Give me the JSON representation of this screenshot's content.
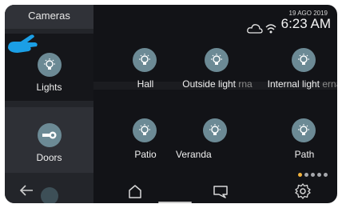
{
  "sidebar": {
    "cameras_label": "Cameras",
    "lights_label": "Lights",
    "doors_label": "Doors",
    "back_icon": "arrow-left-icon",
    "lights_icon": "bulb-icon",
    "doors_icon": "key-icon",
    "pointer_icon": "hand-pointer-icon"
  },
  "status": {
    "date": "19 AGO 2019",
    "time": "6:23 AM",
    "cloud_icon": "cloud-icon",
    "wifi_icon": "wifi-icon"
  },
  "tiles": [
    {
      "label": "Hall",
      "ghost": "",
      "icon": "bulb-icon"
    },
    {
      "label": "Outside light",
      "ghost": "rna",
      "icon": "bulb-icon"
    },
    {
      "label": "Internal light",
      "ghost": "erna",
      "icon": "bulb-icon"
    },
    {
      "label": "Patio",
      "ghost": "",
      "icon": "bulb-icon"
    },
    {
      "label": "Veranda",
      "ghost": "",
      "icon": "bulb-icon"
    },
    {
      "label": "Path",
      "ghost": "",
      "icon": "bulb-icon"
    }
  ],
  "pagination": {
    "pages": 5,
    "active": 1
  },
  "nav": {
    "home_icon": "home-icon",
    "chat_icon": "chat-icon",
    "settings_icon": "gear-icon"
  },
  "colors": {
    "background": "#121317",
    "sidebar": "#23252a",
    "icon_circle": "#6c8a95",
    "accent_dot": "#f2b33d",
    "pointer": "#1b9fe6"
  }
}
